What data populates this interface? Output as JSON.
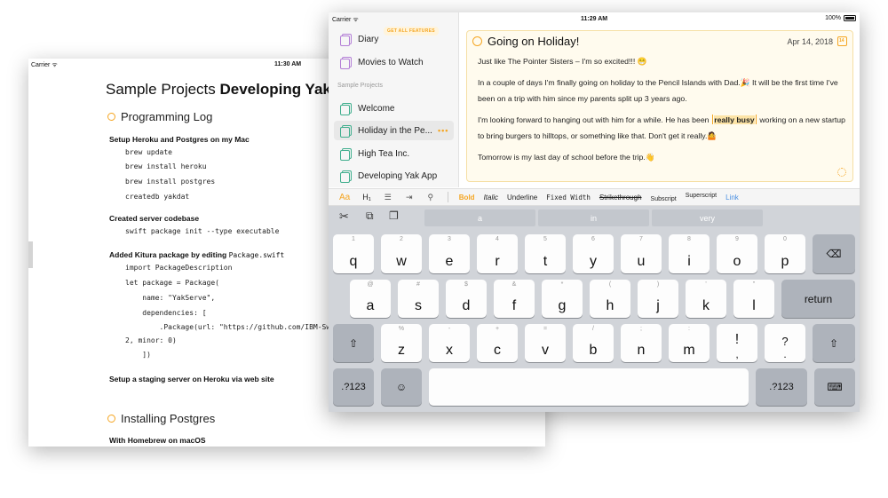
{
  "back_window": {
    "carrier": "Carrier",
    "time": "11:30 AM",
    "title_prefix": "Sample Projects ",
    "title_bold": "Developing Yak App",
    "section1": "Programming Log",
    "heading1": "Setup Heroku and Postgres on my Mac",
    "code1": [
      "brew update",
      "brew install heroku",
      "brew install postgres",
      "createdb yakdat"
    ],
    "heading2": "Created server codebase",
    "code2": [
      "swift package init --type executable"
    ],
    "heading3_text": "Added Kitura package by editing ",
    "heading3_mono": "Package.swift",
    "code3": [
      "import PackageDescription",
      "let package = Package(",
      "    name: \"YakServe\",",
      "    dependencies: [",
      "        .Package(url: \"https://github.com/IBM-Sw",
      "2, minor: 0)",
      "    ])"
    ],
    "heading4": "Setup a staging server on Heroku via web site",
    "section2": "Installing Postgres",
    "heading5": "With Homebrew on macOS"
  },
  "front_window": {
    "carrier": "Carrier",
    "time": "11:29 AM",
    "battery": "100%",
    "get_all_features": "GET ALL FEATURES",
    "sidebar": {
      "items_top": [
        {
          "label": "Diary",
          "color": "#b37ed6"
        },
        {
          "label": "Movies to Watch",
          "color": "#b37ed6"
        }
      ],
      "section_label": "Sample Projects",
      "items_projects": [
        {
          "label": "Welcome"
        },
        {
          "label": "Holiday in the Pe...",
          "more": "•••"
        },
        {
          "label": "High Tea Inc."
        },
        {
          "label": "Developing Yak App"
        }
      ]
    },
    "editor": {
      "title": "Going on Holiday!",
      "date": "Apr 14, 2018",
      "p1": "Just like The Pointer Sisters – I'm so excited!!! 😁",
      "p2": "In a couple of days I'm finally going on holiday to the Pencil Islands with Dad.🎉 It will be the first time I've been on a trip with him since my parents split up 3 years ago.",
      "p3_before": "I'm looking forward to hanging out with him for a while. He has been ",
      "p3_highlight": "really busy",
      "p3_after": " working on a new startup to bring burgers to hilltops, or something like that. Don't get it really.🤷",
      "p4": "Tomorrow is my last day of school before the trip.👋"
    },
    "format_bar": {
      "aa": "Aa",
      "h1": "H₁",
      "list": "☰",
      "bold": "Bold",
      "italic": "Italic",
      "underline": "Underline",
      "fixed": "Fixed Width",
      "strike": "Strikethrough",
      "subscript": "Subscript",
      "superscript": "Superscript",
      "link": "Link"
    },
    "keyboard": {
      "suggestions": [
        "a",
        "in",
        "very"
      ],
      "row1": [
        [
          "q",
          "1"
        ],
        [
          "w",
          "2"
        ],
        [
          "e",
          "3"
        ],
        [
          "r",
          "4"
        ],
        [
          "t",
          "5"
        ],
        [
          "y",
          "6"
        ],
        [
          "u",
          "7"
        ],
        [
          "i",
          "8"
        ],
        [
          "o",
          "9"
        ],
        [
          "p",
          "0"
        ]
      ],
      "row2": [
        [
          "a",
          "@"
        ],
        [
          "s",
          "#"
        ],
        [
          "d",
          "$"
        ],
        [
          "f",
          "&"
        ],
        [
          "g",
          "*"
        ],
        [
          "h",
          "("
        ],
        [
          "j",
          ")"
        ],
        [
          "k",
          "'"
        ],
        [
          "l",
          "\""
        ]
      ],
      "row3": [
        [
          "z",
          "%"
        ],
        [
          "x",
          "-"
        ],
        [
          "c",
          "+"
        ],
        [
          "v",
          "="
        ],
        [
          "b",
          "/"
        ],
        [
          "n",
          ";"
        ],
        [
          "m",
          ":"
        ],
        [
          "!",
          ","
        ],
        [
          "?",
          "."
        ]
      ],
      "return": "return",
      "num_left": ".?123",
      "num_right": ".?123"
    }
  }
}
